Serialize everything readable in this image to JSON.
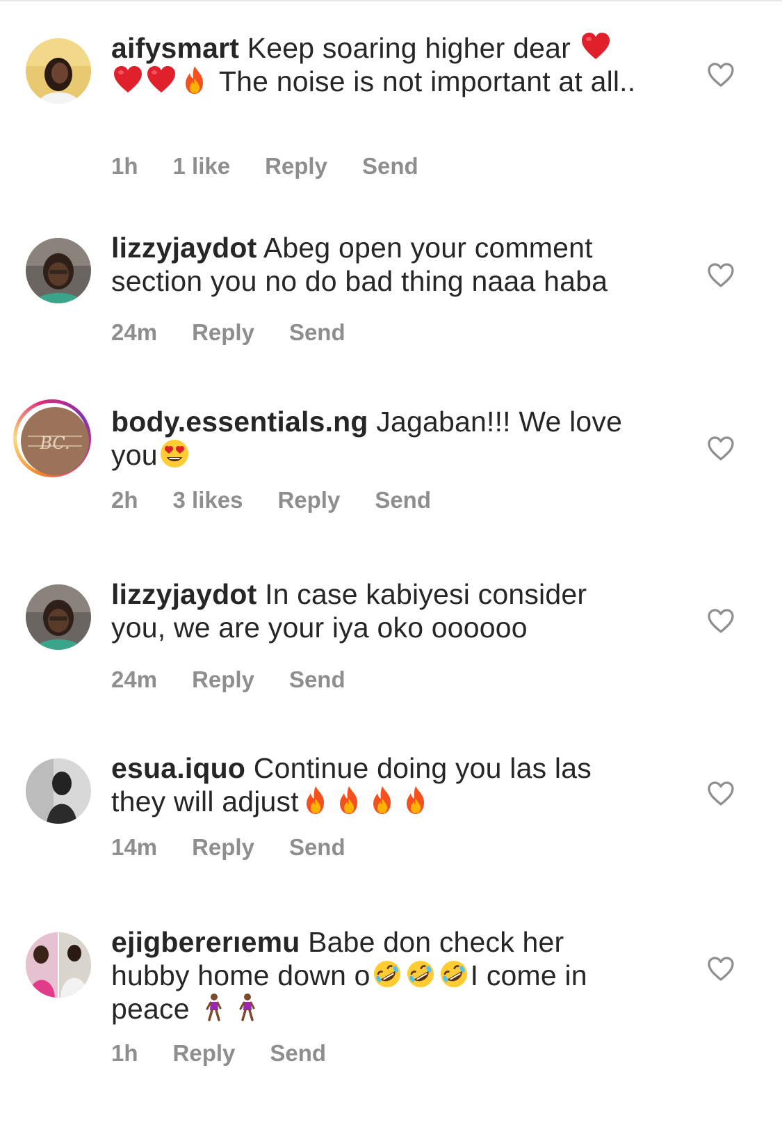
{
  "comments": [
    {
      "username": "aifysmart",
      "text_1": " Keep soaring higher dear ",
      "text_2": " The noise is not important at all..",
      "time": "1h",
      "likes": "1 like",
      "reply": "Reply",
      "send": "Send"
    },
    {
      "username": "lizzyjaydot",
      "text": " Abeg open your comment section you no do bad thing naaa haba",
      "time": "24m",
      "reply": "Reply",
      "send": "Send"
    },
    {
      "username": "body.essentials.ng",
      "text": " Jagaban!!! We love you",
      "time": "2h",
      "likes": "3 likes",
      "reply": "Reply",
      "send": "Send"
    },
    {
      "username": "lizzyjaydot",
      "text": " In case kabiyesi consider you, we are your iya oko oooooo",
      "time": "24m",
      "reply": "Reply",
      "send": "Send"
    },
    {
      "username": "esua.iquo",
      "text": " Continue doing you las las they will adjust",
      "time": "14m",
      "reply": "Reply",
      "send": "Send"
    },
    {
      "username": "ejigbererıemu",
      "text_1": " Babe don check her hubby home down o",
      "text_2": "I come in peace ",
      "time": "1h",
      "reply": "Reply",
      "send": "Send"
    }
  ],
  "colors": {
    "text": "#262626",
    "meta": "#8e8e8e",
    "heart_outline": "#8e8e8e"
  },
  "icons": [
    "heart-outline-icon",
    "red-heart-emoji",
    "fire-emoji",
    "heart-eyes-emoji",
    "rolling-laughing-emoji",
    "woman-walking-emoji"
  ]
}
